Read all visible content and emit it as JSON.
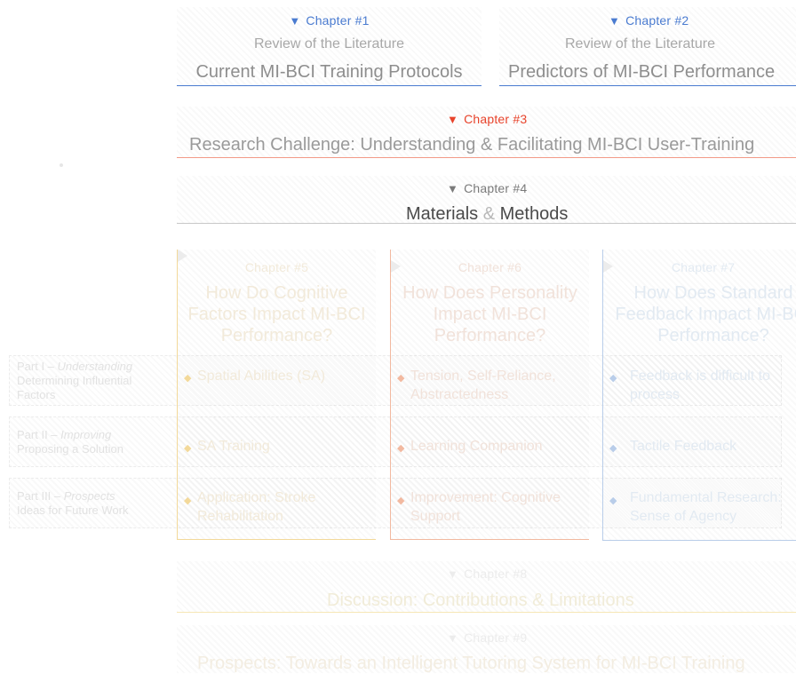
{
  "colors": {
    "blue": "#4a7bd0",
    "red": "#e8432b",
    "gray": "#7a7a7a",
    "yellow_faded": "#f3d99a",
    "orange_faded": "#f2b9a0",
    "blue_faded": "#b9cde9"
  },
  "chapter1": {
    "label": "Chapter #1",
    "subtitle": "Review of the Literature",
    "title": "Current MI-BCI Training Protocols"
  },
  "chapter2": {
    "label": "Chapter #2",
    "subtitle": "Review of the Literature",
    "title": "Predictors of MI-BCI Performance"
  },
  "chapter3": {
    "label": "Chapter #3",
    "title": "Research Challenge: Understanding & Facilitating MI-BCI User-Training"
  },
  "chapter4": {
    "label": "Chapter #4",
    "title_a": "Materials",
    "title_amp": "&",
    "title_b": "Methods"
  },
  "chapter5": {
    "label": "Chapter #5",
    "title": "How Do Cognitive Factors Impact MI-BCI Performance?",
    "items": [
      "Spatial Abilities (SA)",
      "SA Training",
      "Application: Stroke Rehabilitation"
    ]
  },
  "chapter6": {
    "label": "Chapter #6",
    "title": "How Does Personality Impact MI-BCI Performance?",
    "items": [
      "Tension, Self-Reliance, Abstractedness",
      "Learning Companion",
      "Improvement: Cognitive Support"
    ]
  },
  "chapter7": {
    "label": "Chapter #7",
    "title": "How Does Standard Feedback Impact MI-BCI Performance?",
    "items": [
      "Feedback is difficult to process",
      "Tactile Feedback",
      "Fundamental Research: Sense of Agency"
    ]
  },
  "chapter8": {
    "label": "Chapter #8",
    "title": "Discussion: Contributions & Limitations"
  },
  "chapter9": {
    "label": "Chapter #9",
    "title": "Prospects: Towards an Intelligent Tutoring System for MI-BCI Training"
  },
  "parts": [
    {
      "name": "Part I – ",
      "name_it": "Understanding",
      "desc": "Determining Influential Factors"
    },
    {
      "name": "Part II – ",
      "name_it": "Improving",
      "desc": "Proposing a Solution"
    },
    {
      "name": "Part III – ",
      "name_it": "Prospects",
      "desc": "Ideas for Future Work"
    }
  ]
}
